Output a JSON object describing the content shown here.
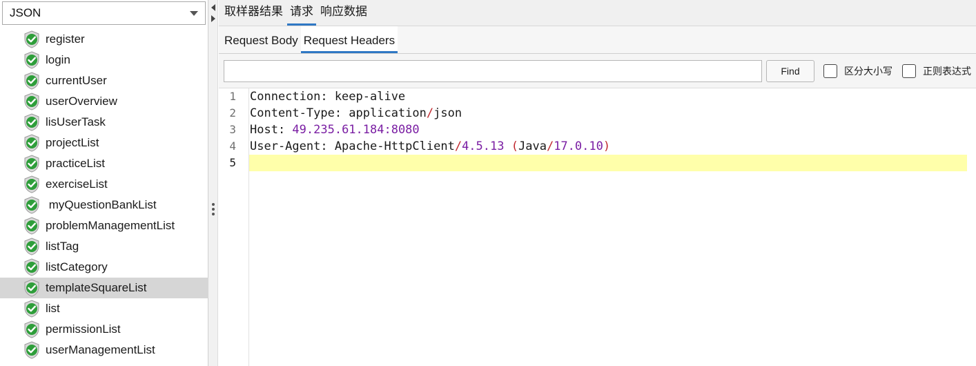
{
  "left": {
    "renderer_select": {
      "value": "JSON"
    },
    "items": [
      {
        "label": "register",
        "selected": false
      },
      {
        "label": "login",
        "selected": false
      },
      {
        "label": "currentUser",
        "selected": false
      },
      {
        "label": "userOverview",
        "selected": false
      },
      {
        "label": "lisUserTask",
        "selected": false
      },
      {
        "label": "projectList",
        "selected": false
      },
      {
        "label": "practiceList",
        "selected": false
      },
      {
        "label": "exerciseList",
        "selected": false
      },
      {
        "label": " myQuestionBankList",
        "selected": false
      },
      {
        "label": "problemManagementList",
        "selected": false
      },
      {
        "label": "listTag",
        "selected": false
      },
      {
        "label": "listCategory",
        "selected": false
      },
      {
        "label": "templateSquareList",
        "selected": true
      },
      {
        "label": "list",
        "selected": false
      },
      {
        "label": "permissionList",
        "selected": false
      },
      {
        "label": "userManagementList",
        "selected": false
      }
    ],
    "item_icon": "success-shield-icon"
  },
  "right": {
    "main_tabs": [
      {
        "label": "取样器结果",
        "active": false
      },
      {
        "label": "请求",
        "active": true
      },
      {
        "label": "响应数据",
        "active": false
      }
    ],
    "sub_tabs": [
      {
        "label": "Request Body",
        "active": false
      },
      {
        "label": "Request Headers",
        "active": true
      }
    ],
    "search": {
      "input_value": "",
      "find_label": "Find",
      "case_sensitive_label": "区分大小写",
      "regex_label": "正则表达式"
    },
    "editor": {
      "current_line": 5,
      "lines": [
        {
          "number": "1",
          "tokens": [
            {
              "t": "Connection: keep-alive",
              "c": "k"
            }
          ]
        },
        {
          "number": "2",
          "tokens": [
            {
              "t": "Content-Type: application",
              "c": "k"
            },
            {
              "t": "/",
              "c": "paren"
            },
            {
              "t": "json",
              "c": "k"
            }
          ]
        },
        {
          "number": "3",
          "tokens": [
            {
              "t": "Host: ",
              "c": "k"
            },
            {
              "t": "49.235.61.184:8080",
              "c": "num"
            }
          ]
        },
        {
          "number": "4",
          "tokens": [
            {
              "t": "User-Agent: Apache-HttpClient",
              "c": "k"
            },
            {
              "t": "/",
              "c": "paren"
            },
            {
              "t": "4.5.13",
              "c": "num"
            },
            {
              "t": " ",
              "c": "k"
            },
            {
              "t": "(",
              "c": "paren"
            },
            {
              "t": "Java",
              "c": "k"
            },
            {
              "t": "/",
              "c": "paren"
            },
            {
              "t": "17.0.10",
              "c": "num"
            },
            {
              "t": ")",
              "c": "paren"
            }
          ]
        },
        {
          "number": "5",
          "tokens": []
        }
      ]
    }
  },
  "colors": {
    "accent_tab_underline": "#2f78c4",
    "current_line_bg": "#ffffaa",
    "selected_item_bg": "#d6d6d6",
    "number_token": "#7a1ea3",
    "punct_token": "#c0272d",
    "shield_green": "#2e9e3a"
  }
}
